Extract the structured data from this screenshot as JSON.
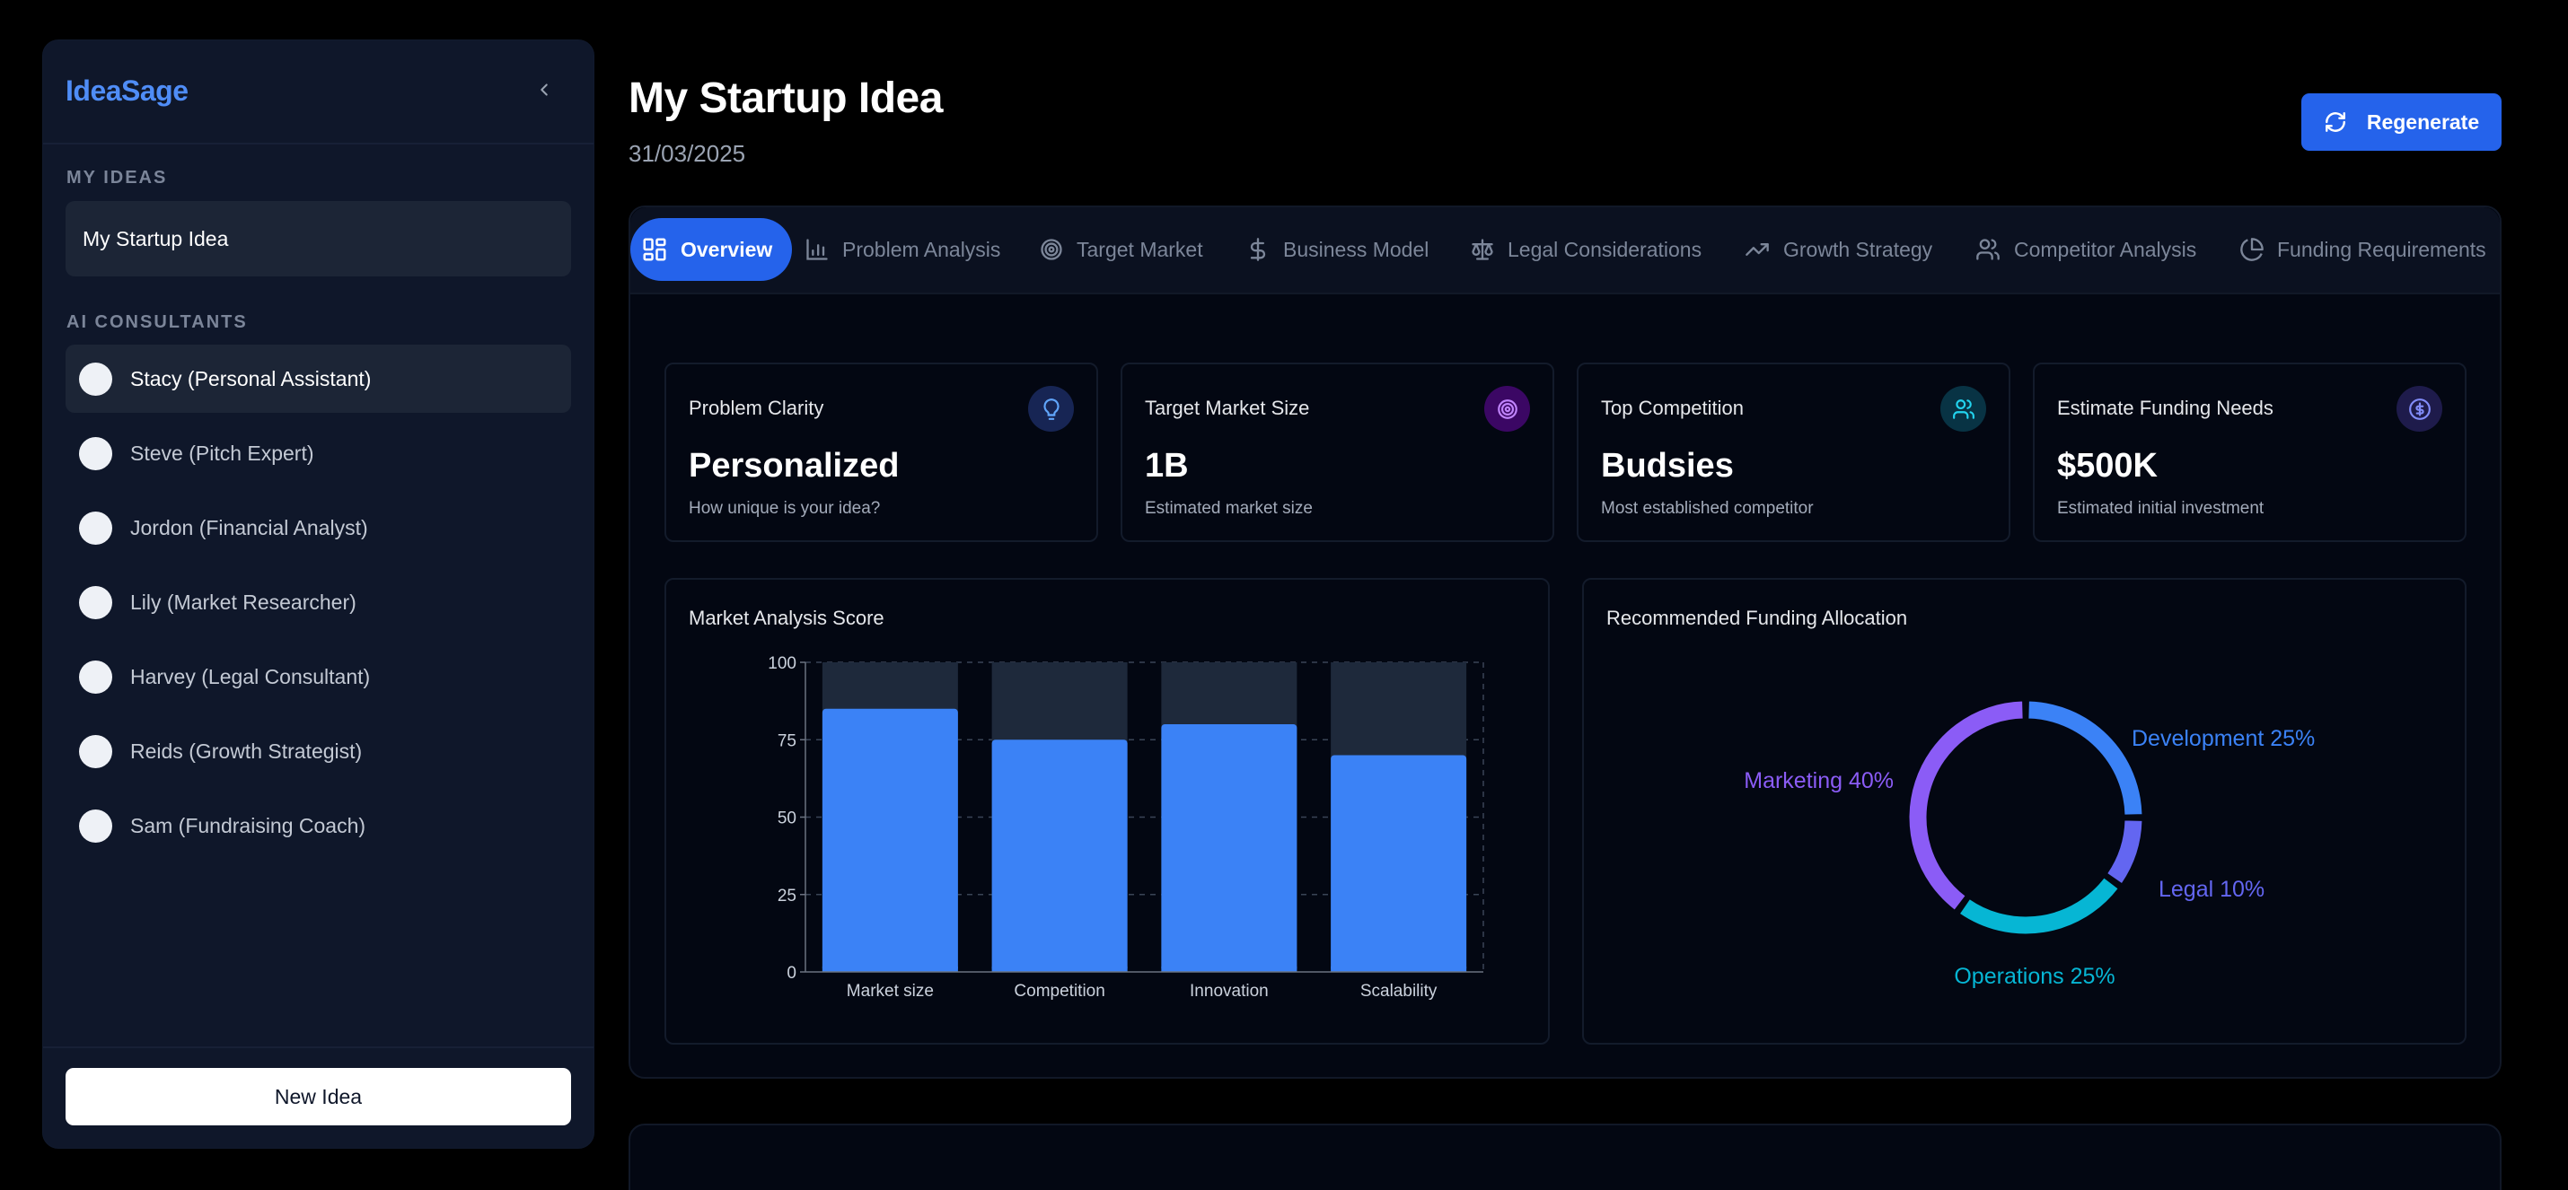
{
  "sidebar": {
    "brand": "IdeaSage",
    "my_ideas_title": "MY IDEAS",
    "ideas": [
      "My Startup Idea"
    ],
    "consultants_title": "AI CONSULTANTS",
    "consultants": [
      "Stacy (Personal Assistant)",
      "Steve (Pitch Expert)",
      "Jordon (Financial Analyst)",
      "Lily (Market Researcher)",
      "Harvey (Legal Consultant)",
      "Reids (Growth Strategist)",
      "Sam (Fundraising Coach)"
    ],
    "new_idea_label": "New Idea"
  },
  "header": {
    "title": "My Startup Idea",
    "date": "31/03/2025",
    "regenerate_label": "Regenerate"
  },
  "tabs": [
    {
      "label": "Overview",
      "icon": "layout-dashboard-icon"
    },
    {
      "label": "Problem Analysis",
      "icon": "bar-chart-icon"
    },
    {
      "label": "Target Market",
      "icon": "target-icon"
    },
    {
      "label": "Business Model",
      "icon": "dollar-icon"
    },
    {
      "label": "Legal Considerations",
      "icon": "scale-icon"
    },
    {
      "label": "Growth Strategy",
      "icon": "trending-up-icon"
    },
    {
      "label": "Competitor Analysis",
      "icon": "users-icon"
    },
    {
      "label": "Funding Requirements",
      "icon": "pie-chart-icon"
    }
  ],
  "stats": [
    {
      "label": "Problem Clarity",
      "value": "Personalized",
      "sub": "How unique is your idea?",
      "icon": "lightbulb-icon",
      "color": "#60a5fa",
      "bg": "#172554"
    },
    {
      "label": "Target Market Size",
      "value": "1B",
      "sub": "Estimated market size",
      "icon": "target-icon",
      "color": "#c084fc",
      "bg": "#3b0764"
    },
    {
      "label": "Top Competition",
      "value": "Budsies",
      "sub": "Most established competitor",
      "icon": "users-icon",
      "color": "#22d3ee",
      "bg": "#083344"
    },
    {
      "label": "Estimate Funding Needs",
      "value": "$500K",
      "sub": "Estimated initial investment",
      "icon": "dollar-circle-icon",
      "color": "#818cf8",
      "bg": "#1e1b4b"
    }
  ],
  "colors": {
    "accent": "#2563eb",
    "bar": "#3b82f6",
    "bar_bg": "#1e293b"
  },
  "chart_data": [
    {
      "type": "bar",
      "title": "Market Analysis Score",
      "categories": [
        "Market size",
        "Competition",
        "Innovation",
        "Scalability"
      ],
      "values": [
        85,
        75,
        80,
        70
      ],
      "ylim": [
        0,
        100
      ],
      "yticks": [
        0,
        25,
        50,
        75,
        100
      ],
      "grid": true
    },
    {
      "type": "pie",
      "title": "Recommended Funding Allocation",
      "slices": [
        {
          "label": "Development",
          "value": 25,
          "text": "Development 25%",
          "color": "#3b82f6"
        },
        {
          "label": "Legal",
          "value": 10,
          "text": "Legal 10%",
          "color": "#6366f1"
        },
        {
          "label": "Operations",
          "value": 25,
          "text": "Operations 25%",
          "color": "#06b6d4"
        },
        {
          "label": "Marketing",
          "value": 40,
          "text": "Marketing 40%",
          "color": "#8b5cf6"
        }
      ]
    }
  ]
}
